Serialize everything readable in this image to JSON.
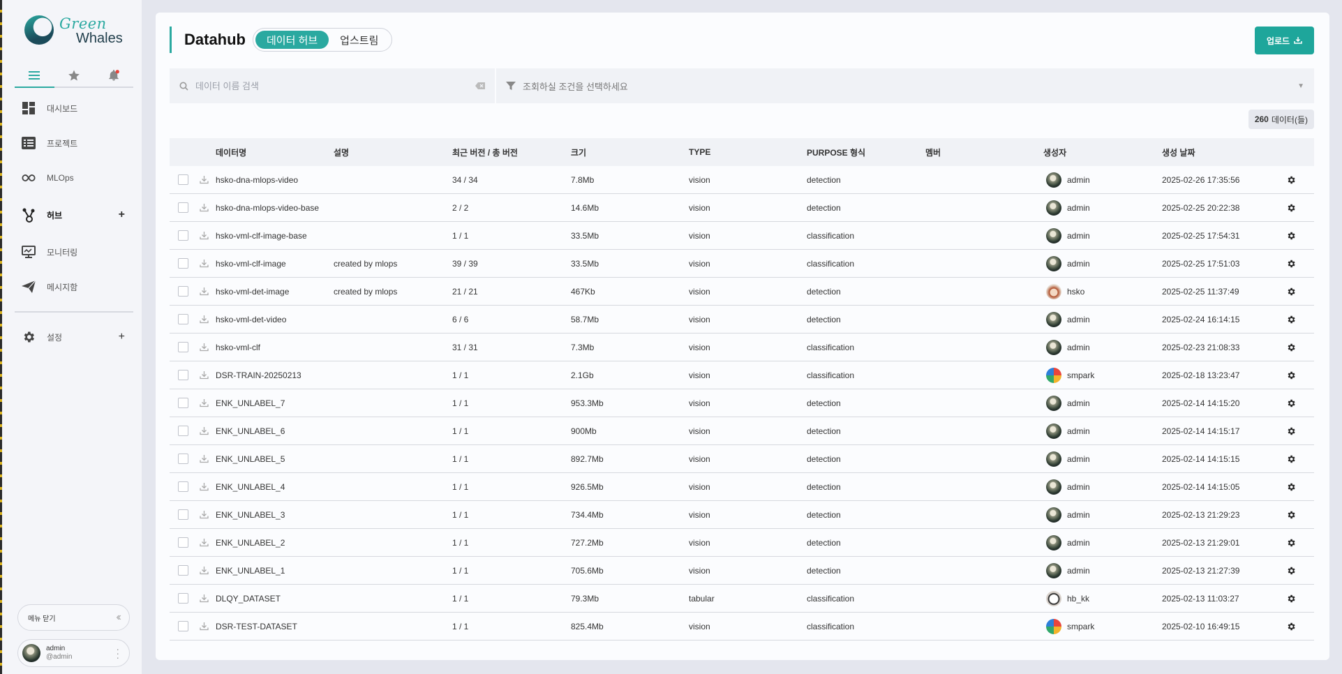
{
  "brand": {
    "line1": "Green",
    "line2": "Whales"
  },
  "sidebar": {
    "tabs": [
      {
        "icon": "menu-icon"
      },
      {
        "icon": "star-icon"
      },
      {
        "icon": "bell-icon"
      }
    ],
    "items": [
      {
        "label": "대시보드",
        "icon": "dashboard-icon"
      },
      {
        "label": "프로젝트",
        "icon": "list-icon"
      },
      {
        "label": "MLOps",
        "icon": "infinity-icon"
      },
      {
        "label": "허브",
        "icon": "hub-icon",
        "plus": "+"
      },
      {
        "label": "모니터링",
        "icon": "monitor-icon"
      },
      {
        "label": "메시지함",
        "icon": "send-icon"
      },
      {
        "label": "설정",
        "icon": "gear-icon",
        "plus": "+"
      }
    ],
    "collapse_label": "메뉴 닫기",
    "user": {
      "name": "admin",
      "handle": "@admin"
    }
  },
  "header": {
    "title": "Datahub",
    "toggle": [
      "데이터 허브",
      "업스트림"
    ],
    "upload_label": "업로드"
  },
  "filters": {
    "search_placeholder": "데이터 이름 검색",
    "condition_placeholder": "조회하실 조건을 선택하세요"
  },
  "count": {
    "value": "260",
    "unit": "데이터(들)"
  },
  "table": {
    "columns": [
      "데이터명",
      "설명",
      "최근 버전 / 총 버전",
      "크기",
      "TYPE",
      "PURPOSE 형식",
      "멤버",
      "생성자",
      "생성 날짜"
    ],
    "rows": [
      {
        "name": "hsko-dna-mlops-video",
        "desc": "",
        "version": "34 / 34",
        "size": "7.8Mb",
        "type": "vision",
        "purpose": "detection",
        "member": "",
        "creator": "admin",
        "date": "2025-02-26 17:35:56"
      },
      {
        "name": "hsko-dna-mlops-video-base",
        "desc": "",
        "version": "2 / 2",
        "size": "14.6Mb",
        "type": "vision",
        "purpose": "detection",
        "member": "",
        "creator": "admin",
        "date": "2025-02-25 20:22:38"
      },
      {
        "name": "hsko-vml-clf-image-base",
        "desc": "",
        "version": "1 / 1",
        "size": "33.5Mb",
        "type": "vision",
        "purpose": "classification",
        "member": "",
        "creator": "admin",
        "date": "2025-02-25 17:54:31"
      },
      {
        "name": "hsko-vml-clf-image",
        "desc": "created by mlops",
        "version": "39 / 39",
        "size": "33.5Mb",
        "type": "vision",
        "purpose": "classification",
        "member": "",
        "creator": "admin",
        "date": "2025-02-25 17:51:03"
      },
      {
        "name": "hsko-vml-det-image",
        "desc": "created by mlops",
        "version": "21 / 21",
        "size": "467Kb",
        "type": "vision",
        "purpose": "detection",
        "member": "",
        "creator": "hsko",
        "date": "2025-02-25 11:37:49"
      },
      {
        "name": "hsko-vml-det-video",
        "desc": "",
        "version": "6 / 6",
        "size": "58.7Mb",
        "type": "vision",
        "purpose": "detection",
        "member": "",
        "creator": "admin",
        "date": "2025-02-24 16:14:15"
      },
      {
        "name": "hsko-vml-clf",
        "desc": "",
        "version": "31 / 31",
        "size": "7.3Mb",
        "type": "vision",
        "purpose": "classification",
        "member": "",
        "creator": "admin",
        "date": "2025-02-23 21:08:33"
      },
      {
        "name": "DSR-TRAIN-20250213",
        "desc": "",
        "version": "1 / 1",
        "size": "2.1Gb",
        "type": "vision",
        "purpose": "classification",
        "member": "",
        "creator": "smpark",
        "date": "2025-02-18 13:23:47"
      },
      {
        "name": "ENK_UNLABEL_7",
        "desc": "",
        "version": "1 / 1",
        "size": "953.3Mb",
        "type": "vision",
        "purpose": "detection",
        "member": "",
        "creator": "admin",
        "date": "2025-02-14 14:15:20"
      },
      {
        "name": "ENK_UNLABEL_6",
        "desc": "",
        "version": "1 / 1",
        "size": "900Mb",
        "type": "vision",
        "purpose": "detection",
        "member": "",
        "creator": "admin",
        "date": "2025-02-14 14:15:17"
      },
      {
        "name": "ENK_UNLABEL_5",
        "desc": "",
        "version": "1 / 1",
        "size": "892.7Mb",
        "type": "vision",
        "purpose": "detection",
        "member": "",
        "creator": "admin",
        "date": "2025-02-14 14:15:15"
      },
      {
        "name": "ENK_UNLABEL_4",
        "desc": "",
        "version": "1 / 1",
        "size": "926.5Mb",
        "type": "vision",
        "purpose": "detection",
        "member": "",
        "creator": "admin",
        "date": "2025-02-14 14:15:05"
      },
      {
        "name": "ENK_UNLABEL_3",
        "desc": "",
        "version": "1 / 1",
        "size": "734.4Mb",
        "type": "vision",
        "purpose": "detection",
        "member": "",
        "creator": "admin",
        "date": "2025-02-13 21:29:23"
      },
      {
        "name": "ENK_UNLABEL_2",
        "desc": "",
        "version": "1 / 1",
        "size": "727.2Mb",
        "type": "vision",
        "purpose": "detection",
        "member": "",
        "creator": "admin",
        "date": "2025-02-13 21:29:01"
      },
      {
        "name": "ENK_UNLABEL_1",
        "desc": "",
        "version": "1 / 1",
        "size": "705.6Mb",
        "type": "vision",
        "purpose": "detection",
        "member": "",
        "creator": "admin",
        "date": "2025-02-13 21:27:39"
      },
      {
        "name": "DLQY_DATASET",
        "desc": "",
        "version": "1 / 1",
        "size": "79.3Mb",
        "type": "tabular",
        "purpose": "classification",
        "member": "",
        "creator": "hb_kk",
        "date": "2025-02-13 11:03:27"
      },
      {
        "name": "DSR-TEST-DATASET",
        "desc": "",
        "version": "1 / 1",
        "size": "825.4Mb",
        "type": "vision",
        "purpose": "classification",
        "member": "",
        "creator": "smpark",
        "date": "2025-02-10 16:49:15"
      }
    ]
  },
  "colors": {
    "accent": "#2aa9a0",
    "upload_button": "#1ea69b",
    "bell_dot": "#e8453c"
  }
}
